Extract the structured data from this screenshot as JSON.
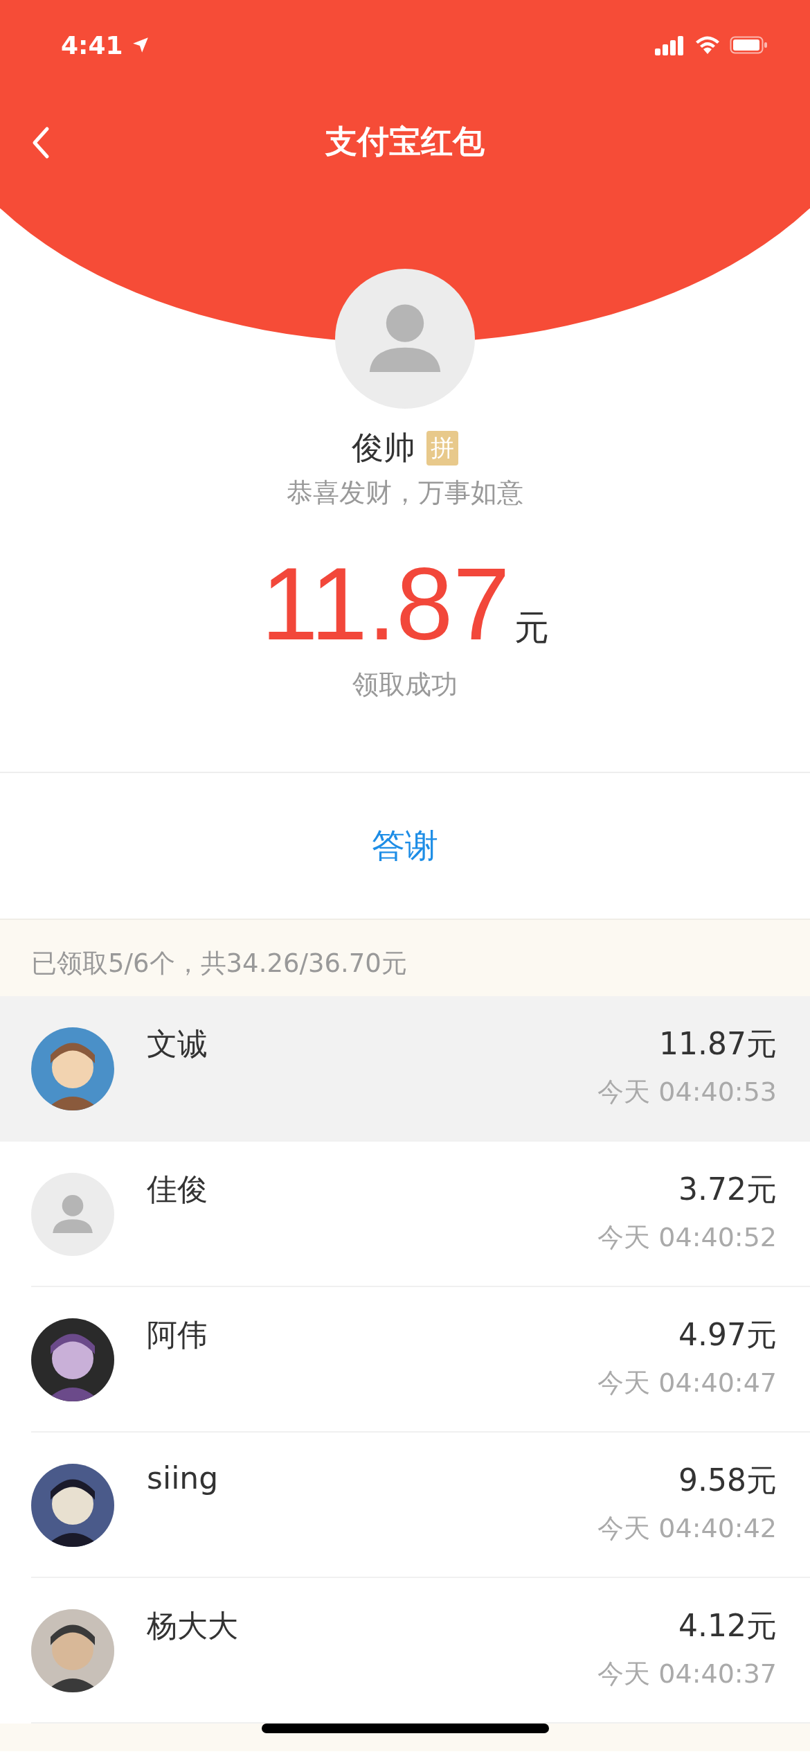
{
  "status_bar": {
    "time": "4:41"
  },
  "nav": {
    "title": "支付宝红包"
  },
  "sender": {
    "name": "俊帅",
    "badge": "拼",
    "greeting": "恭喜发财，万事如意"
  },
  "amount": {
    "value": "11.87",
    "unit": "元",
    "status": "领取成功"
  },
  "thanks_button": "答谢",
  "summary": "已领取5/6个，共34.26/36.70元",
  "recipients": [
    {
      "name": "文诚",
      "amount": "11.87元",
      "time": "今天 04:40:53",
      "kind": "picture",
      "selected": true
    },
    {
      "name": "佳俊",
      "amount": "3.72元",
      "time": "今天 04:40:52",
      "kind": "default",
      "selected": false
    },
    {
      "name": "阿伟",
      "amount": "4.97元",
      "time": "今天 04:40:47",
      "kind": "picture",
      "selected": false
    },
    {
      "name": "siing",
      "amount": "9.58元",
      "time": "今天 04:40:42",
      "kind": "picture",
      "selected": false
    },
    {
      "name": "杨大大",
      "amount": "4.12元",
      "time": "今天 04:40:37",
      "kind": "picture",
      "selected": false
    }
  ]
}
